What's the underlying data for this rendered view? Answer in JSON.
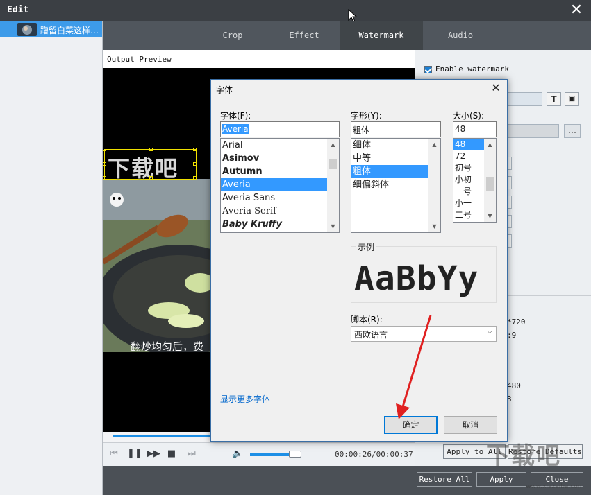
{
  "window": {
    "title": "Edit",
    "close_glyph": "✕"
  },
  "file_list": {
    "items": [
      {
        "name": "蹭留白菜这样…",
        "selected": true
      }
    ]
  },
  "tabs": [
    {
      "label": "Crop",
      "active": false
    },
    {
      "label": "Effect",
      "active": false
    },
    {
      "label": "Watermark",
      "active": true
    },
    {
      "label": "Audio",
      "active": false
    }
  ],
  "preview": {
    "label": "Output Preview",
    "watermark_text": "下载吧",
    "subtitle": "翻炒均匀后，费",
    "time": "00:00:26/00:00:37",
    "progress": 0.33,
    "volume": 0.85
  },
  "watermark_panel": {
    "enable_label": "Enable watermark",
    "enabled": true,
    "font_button_glyph": "T",
    "fragments": [
      "*720",
      ":9",
      "480",
      "3"
    ],
    "apply_all_label": "Apply to All",
    "restore_defaults_label": "Restore Defaults"
  },
  "bottom_bar": {
    "restore_all_label": "Restore All",
    "apply_label": "Apply",
    "close_label": "Close"
  },
  "font_dialog": {
    "title": "字体",
    "font_label": "字体(F):",
    "font_value": "Averia",
    "fonts": [
      "Arial",
      "Asimov",
      "Autumn",
      "Averia",
      "Averia Sans",
      "Averia Serif",
      "Baby Kruffy"
    ],
    "selected_font": "Averia",
    "style_label": "字形(Y):",
    "style_value": "粗体",
    "styles": [
      "细体",
      "中等",
      "粗体",
      "细偏斜体"
    ],
    "selected_style": "粗体",
    "size_label": "大小(S):",
    "size_value": "48",
    "sizes": [
      "48",
      "72",
      "初号",
      "小初",
      "一号",
      "小一",
      "二号"
    ],
    "selected_size": "48",
    "sample_label": "示例",
    "sample_text": "AaBbYy",
    "script_label": "脚本(R):",
    "script_value": "西欧语言",
    "more_fonts_link": "显示更多字体",
    "ok_label": "确定",
    "cancel_label": "取消"
  },
  "site_watermark": {
    "text": "下载吧",
    "url": "www.xiazaiba.com"
  },
  "colors": {
    "accent": "#3399ff",
    "titlebar": "#3b3f44",
    "arrow": "#e02020",
    "selected_file": "#3d9be9"
  }
}
